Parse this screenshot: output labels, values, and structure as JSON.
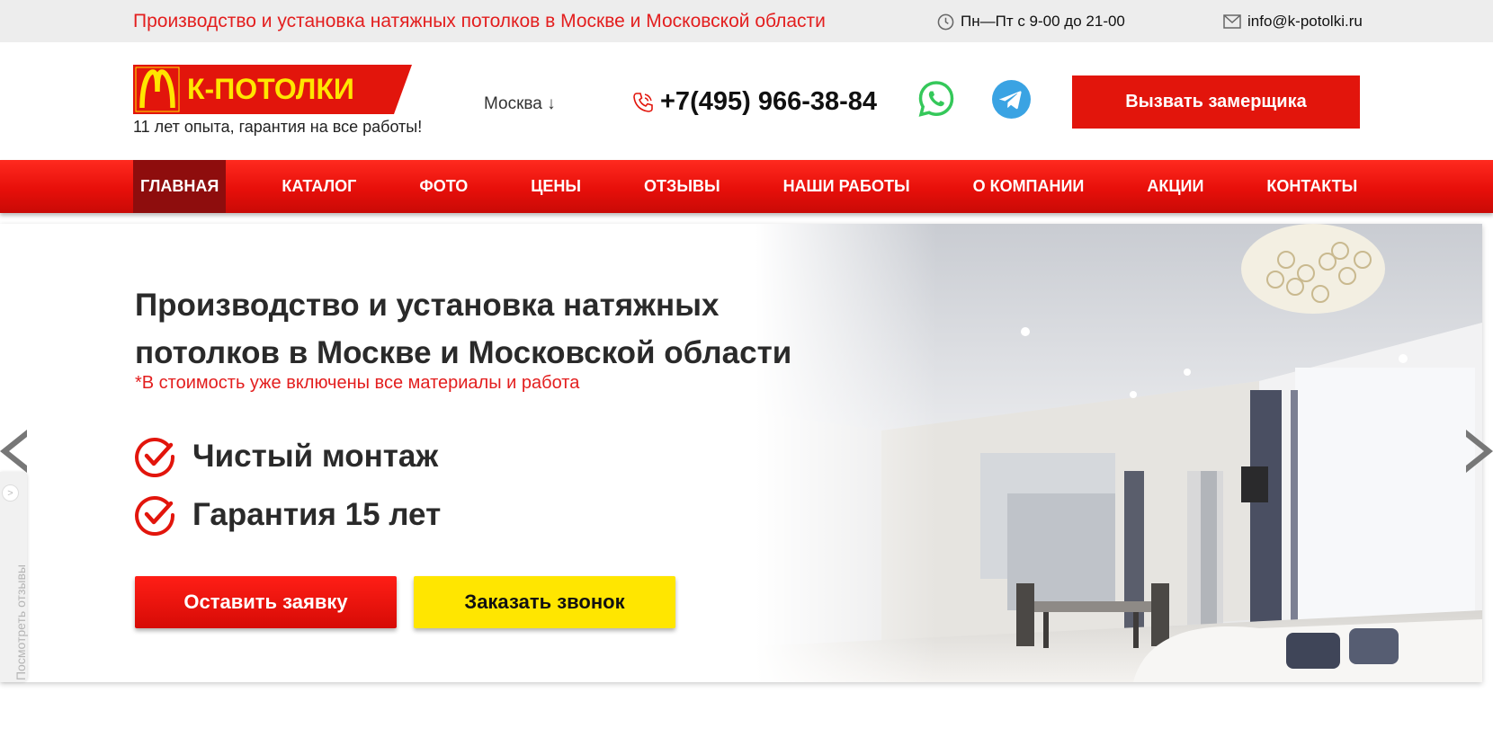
{
  "topbar": {
    "tagline": "Производство и установка натяжных потолков в Москве и Московской области",
    "hours": "Пн—Пт с 9-00 до 21-00",
    "email": "info@k-potolki.ru"
  },
  "header": {
    "logo_text": "К-ПОТОЛКИ",
    "logo_subtitle": "11 лет опыта, гарантия на все работы!",
    "city": "Москва ↓",
    "phone": "+7(495) 966-38-84",
    "cta_label": "Вызвать замерщика"
  },
  "nav": {
    "items": [
      {
        "label": "ГЛАВНАЯ",
        "active": true
      },
      {
        "label": "КАТАЛОГ",
        "active": false
      },
      {
        "label": "ФОТО",
        "active": false
      },
      {
        "label": "ЦЕНЫ",
        "active": false
      },
      {
        "label": "ОТЗЫВЫ",
        "active": false
      },
      {
        "label": "НАШИ РАБОТЫ",
        "active": false
      },
      {
        "label": "О КОМПАНИИ",
        "active": false
      },
      {
        "label": "АКЦИИ",
        "active": false
      },
      {
        "label": "КОНТАКТЫ",
        "active": false
      }
    ]
  },
  "hero": {
    "title": "Производство и установка натяжных потолков в Москве и Московской области",
    "note": "*В стоимость уже включены все материалы и работа",
    "features": [
      "Чистый монтаж",
      "Гарантия 15 лет"
    ],
    "btn_request": "Оставить заявку",
    "btn_callback": "Заказать звонок"
  },
  "side_tab": {
    "label": "Посмотреть отзывы"
  },
  "colors": {
    "brand_red": "#e2150c",
    "nav_active": "#8e0d0d",
    "accent_yellow": "#ffe600",
    "logo_yellow": "#ffe600"
  },
  "icons": {
    "hours": "clock-icon",
    "email": "envelope-icon",
    "phone": "phone-icon",
    "whatsapp": "whatsapp-icon",
    "telegram": "telegram-icon",
    "check": "check-circle-icon",
    "prev": "chevron-left-icon",
    "next": "chevron-right-icon"
  }
}
